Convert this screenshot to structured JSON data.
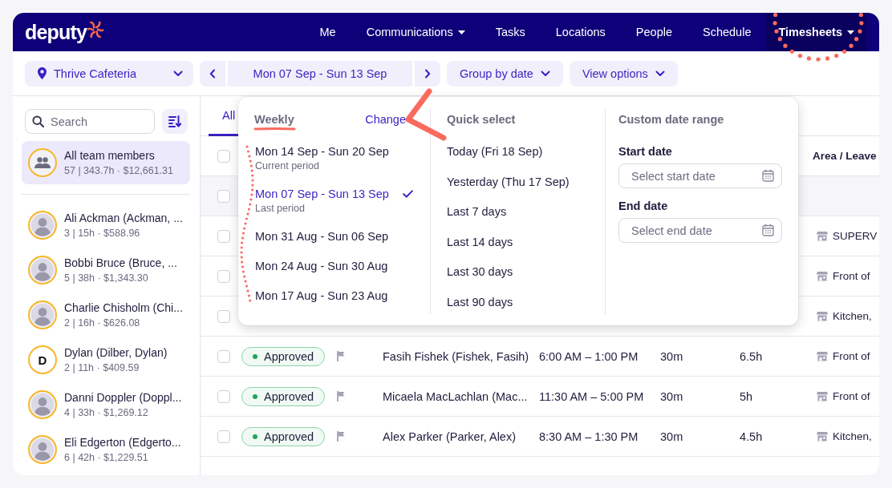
{
  "nav": {
    "logo": "deputy",
    "items": [
      {
        "label": "Me",
        "selected": false,
        "dropdown": false
      },
      {
        "label": "Communications",
        "selected": false,
        "dropdown": true
      },
      {
        "label": "Tasks",
        "selected": false,
        "dropdown": false
      },
      {
        "label": "Locations",
        "selected": false,
        "dropdown": false
      },
      {
        "label": "People",
        "selected": false,
        "dropdown": false
      },
      {
        "label": "Schedule",
        "selected": false,
        "dropdown": false
      },
      {
        "label": "Timesheets",
        "selected": true,
        "dropdown": true
      }
    ]
  },
  "toolbar": {
    "location": "Thrive Cafeteria",
    "date_range": "Mon 07 Sep - Sun 13 Sep",
    "group_by": "Group by date",
    "view_options": "View options"
  },
  "sidebar": {
    "search": {
      "placeholder": "Search"
    },
    "all": {
      "name": "All team members",
      "summary": "57 | 343.7h · $12,661.31",
      "selected": true
    },
    "members": [
      {
        "name": "Ali Ackman (Ackman, ...",
        "summary": "3 | 15h · $588.96",
        "kind": "photo",
        "selected": false
      },
      {
        "name": "Bobbi Bruce (Bruce, ...",
        "summary": "5 | 38h · $1,343.30",
        "kind": "photo",
        "selected": false
      },
      {
        "name": "Charlie Chisholm (Chi...",
        "summary": "2 | 16h · $626.08",
        "kind": "photo",
        "selected": false
      },
      {
        "name": "Dylan (Dilber, Dylan)",
        "summary": "2 | 11h · $409.59",
        "kind": "initial",
        "initial": "D",
        "selected": false
      },
      {
        "name": "Danni Doppler (Doppl...",
        "summary": "4 | 33h · $1,269.12",
        "kind": "photo",
        "selected": false
      },
      {
        "name": "Eli Edgerton (Edgerto...",
        "summary": "6 | 42h · $1,229.51",
        "kind": "photo",
        "selected": false
      }
    ]
  },
  "tabs": [
    {
      "label": "All",
      "selected": true
    }
  ],
  "table": {
    "select_all_checked": false,
    "columns": [
      {
        "label": "Area / Leave"
      }
    ],
    "rows": [
      {
        "kind": "group",
        "checked": false
      },
      {
        "kind": "shift",
        "checked": false,
        "area": "SUPERV"
      },
      {
        "kind": "shift",
        "checked": false,
        "area": "Front of"
      },
      {
        "kind": "shift",
        "checked": false,
        "area": "Kitchen,"
      },
      {
        "kind": "shift",
        "checked": false,
        "status": "Approved",
        "flagged": false,
        "employee": "Fasih Fishek (Fishek, Fasih)",
        "time": "6:00 AM – 1:00 PM",
        "break": "30m",
        "hours": "6.5h",
        "area": "Front of"
      },
      {
        "kind": "shift",
        "checked": false,
        "status": "Approved",
        "flagged": false,
        "employee": "Micaela MacLachlan (Mac...",
        "time": "11:30 AM – 5:00 PM",
        "break": "30m",
        "hours": "5h",
        "area": "Front of"
      },
      {
        "kind": "shift",
        "checked": false,
        "status": "Approved",
        "flagged": false,
        "employee": "Alex Parker (Parker, Alex)",
        "time": "8:30 AM – 1:30 PM",
        "break": "30m",
        "hours": "4.5h",
        "area": "Kitchen,"
      }
    ]
  },
  "popover": {
    "weekly": {
      "title": "Weekly",
      "change": "Change",
      "periods": [
        {
          "label": "Mon 14 Sep - Sun 20 Sep",
          "note": "Current period",
          "selected": false
        },
        {
          "label": "Mon 07 Sep - Sun 13 Sep",
          "note": "Last period",
          "selected": true
        },
        {
          "label": "Mon 31 Aug - Sun 06 Sep",
          "selected": false
        },
        {
          "label": "Mon 24 Aug - Sun 30 Aug",
          "selected": false
        },
        {
          "label": "Mon 17 Aug - Sun 23 Aug",
          "selected": false
        }
      ]
    },
    "quick": {
      "title": "Quick select",
      "options": [
        "Today (Fri 18 Sep)",
        "Yesterday (Thu 17 Sep)",
        "Last 7 days",
        "Last 14 days",
        "Last 30 days",
        "Last 90 days"
      ]
    },
    "custom": {
      "title": "Custom date range",
      "start": {
        "label": "Start date",
        "placeholder": "Select start date"
      },
      "end": {
        "label": "End date",
        "placeholder": "Select end date"
      }
    }
  },
  "annotations": [
    {
      "kind": "circle"
    },
    {
      "kind": "underline"
    },
    {
      "kind": "arrow"
    },
    {
      "kind": "wave"
    }
  ]
}
